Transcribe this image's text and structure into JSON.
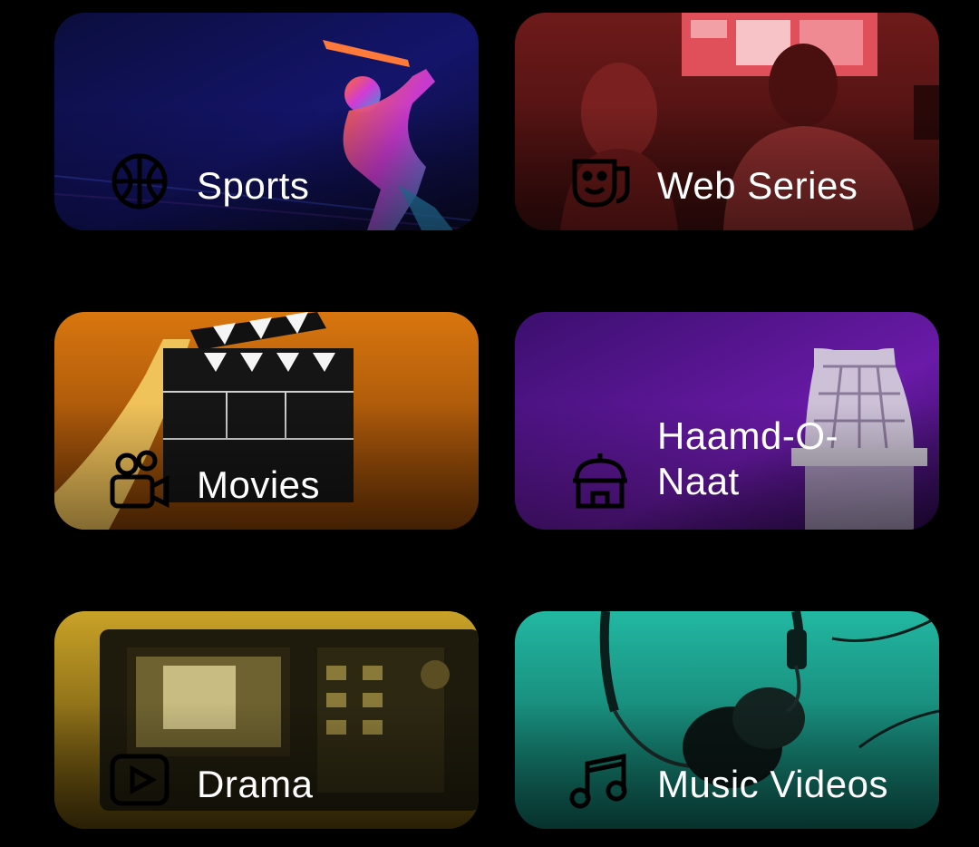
{
  "categories": [
    {
      "id": "sports",
      "label": "Sports",
      "icon": "basketball-icon",
      "accent": "#1a1f6e"
    },
    {
      "id": "web_series",
      "label": "Web Series",
      "icon": "theater-mask-icon",
      "accent": "#8f2626"
    },
    {
      "id": "movies",
      "label": "Movies",
      "icon": "video-camera-icon",
      "accent": "#d9760f"
    },
    {
      "id": "haamd_o_naat",
      "label": "Haamd-O-Naat",
      "icon": "mosque-icon",
      "accent": "#6a1aa8"
    },
    {
      "id": "drama",
      "label": "Drama",
      "icon": "play-square-icon",
      "accent": "#c9a227"
    },
    {
      "id": "music_videos",
      "label": "Music Videos",
      "icon": "music-note-icon",
      "accent": "#1aa390"
    }
  ]
}
